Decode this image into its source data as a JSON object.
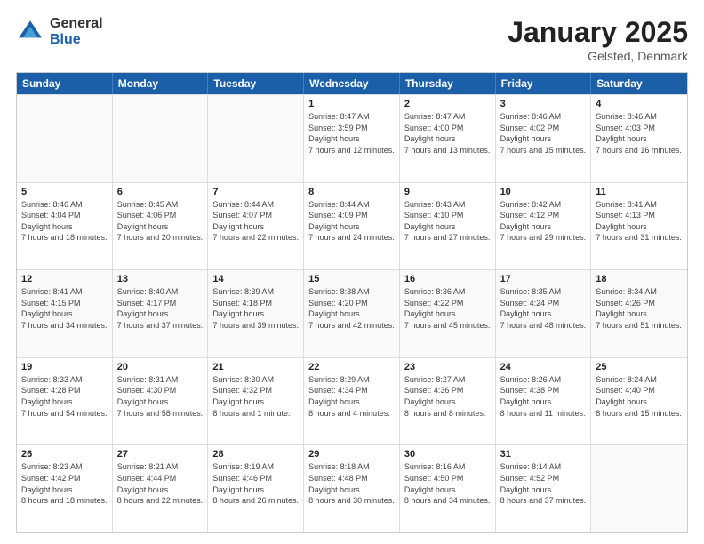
{
  "logo": {
    "general": "General",
    "blue": "Blue"
  },
  "title": "January 2025",
  "location": "Gelsted, Denmark",
  "days_of_week": [
    "Sunday",
    "Monday",
    "Tuesday",
    "Wednesday",
    "Thursday",
    "Friday",
    "Saturday"
  ],
  "weeks": [
    [
      {
        "day": "",
        "empty": true
      },
      {
        "day": "",
        "empty": true
      },
      {
        "day": "",
        "empty": true
      },
      {
        "day": "1",
        "sunrise": "8:47 AM",
        "sunset": "3:59 PM",
        "daylight": "7 hours and 12 minutes."
      },
      {
        "day": "2",
        "sunrise": "8:47 AM",
        "sunset": "4:00 PM",
        "daylight": "7 hours and 13 minutes."
      },
      {
        "day": "3",
        "sunrise": "8:46 AM",
        "sunset": "4:02 PM",
        "daylight": "7 hours and 15 minutes."
      },
      {
        "day": "4",
        "sunrise": "8:46 AM",
        "sunset": "4:03 PM",
        "daylight": "7 hours and 16 minutes."
      }
    ],
    [
      {
        "day": "5",
        "sunrise": "8:46 AM",
        "sunset": "4:04 PM",
        "daylight": "7 hours and 18 minutes."
      },
      {
        "day": "6",
        "sunrise": "8:45 AM",
        "sunset": "4:06 PM",
        "daylight": "7 hours and 20 minutes."
      },
      {
        "day": "7",
        "sunrise": "8:44 AM",
        "sunset": "4:07 PM",
        "daylight": "7 hours and 22 minutes."
      },
      {
        "day": "8",
        "sunrise": "8:44 AM",
        "sunset": "4:09 PM",
        "daylight": "7 hours and 24 minutes."
      },
      {
        "day": "9",
        "sunrise": "8:43 AM",
        "sunset": "4:10 PM",
        "daylight": "7 hours and 27 minutes."
      },
      {
        "day": "10",
        "sunrise": "8:42 AM",
        "sunset": "4:12 PM",
        "daylight": "7 hours and 29 minutes."
      },
      {
        "day": "11",
        "sunrise": "8:41 AM",
        "sunset": "4:13 PM",
        "daylight": "7 hours and 31 minutes."
      }
    ],
    [
      {
        "day": "12",
        "sunrise": "8:41 AM",
        "sunset": "4:15 PM",
        "daylight": "7 hours and 34 minutes."
      },
      {
        "day": "13",
        "sunrise": "8:40 AM",
        "sunset": "4:17 PM",
        "daylight": "7 hours and 37 minutes."
      },
      {
        "day": "14",
        "sunrise": "8:39 AM",
        "sunset": "4:18 PM",
        "daylight": "7 hours and 39 minutes."
      },
      {
        "day": "15",
        "sunrise": "8:38 AM",
        "sunset": "4:20 PM",
        "daylight": "7 hours and 42 minutes."
      },
      {
        "day": "16",
        "sunrise": "8:36 AM",
        "sunset": "4:22 PM",
        "daylight": "7 hours and 45 minutes."
      },
      {
        "day": "17",
        "sunrise": "8:35 AM",
        "sunset": "4:24 PM",
        "daylight": "7 hours and 48 minutes."
      },
      {
        "day": "18",
        "sunrise": "8:34 AM",
        "sunset": "4:26 PM",
        "daylight": "7 hours and 51 minutes."
      }
    ],
    [
      {
        "day": "19",
        "sunrise": "8:33 AM",
        "sunset": "4:28 PM",
        "daylight": "7 hours and 54 minutes."
      },
      {
        "day": "20",
        "sunrise": "8:31 AM",
        "sunset": "4:30 PM",
        "daylight": "7 hours and 58 minutes."
      },
      {
        "day": "21",
        "sunrise": "8:30 AM",
        "sunset": "4:32 PM",
        "daylight": "8 hours and 1 minute."
      },
      {
        "day": "22",
        "sunrise": "8:29 AM",
        "sunset": "4:34 PM",
        "daylight": "8 hours and 4 minutes."
      },
      {
        "day": "23",
        "sunrise": "8:27 AM",
        "sunset": "4:36 PM",
        "daylight": "8 hours and 8 minutes."
      },
      {
        "day": "24",
        "sunrise": "8:26 AM",
        "sunset": "4:38 PM",
        "daylight": "8 hours and 11 minutes."
      },
      {
        "day": "25",
        "sunrise": "8:24 AM",
        "sunset": "4:40 PM",
        "daylight": "8 hours and 15 minutes."
      }
    ],
    [
      {
        "day": "26",
        "sunrise": "8:23 AM",
        "sunset": "4:42 PM",
        "daylight": "8 hours and 18 minutes."
      },
      {
        "day": "27",
        "sunrise": "8:21 AM",
        "sunset": "4:44 PM",
        "daylight": "8 hours and 22 minutes."
      },
      {
        "day": "28",
        "sunrise": "8:19 AM",
        "sunset": "4:46 PM",
        "daylight": "8 hours and 26 minutes."
      },
      {
        "day": "29",
        "sunrise": "8:18 AM",
        "sunset": "4:48 PM",
        "daylight": "8 hours and 30 minutes."
      },
      {
        "day": "30",
        "sunrise": "8:16 AM",
        "sunset": "4:50 PM",
        "daylight": "8 hours and 34 minutes."
      },
      {
        "day": "31",
        "sunrise": "8:14 AM",
        "sunset": "4:52 PM",
        "daylight": "8 hours and 37 minutes."
      },
      {
        "day": "",
        "empty": true
      }
    ]
  ]
}
